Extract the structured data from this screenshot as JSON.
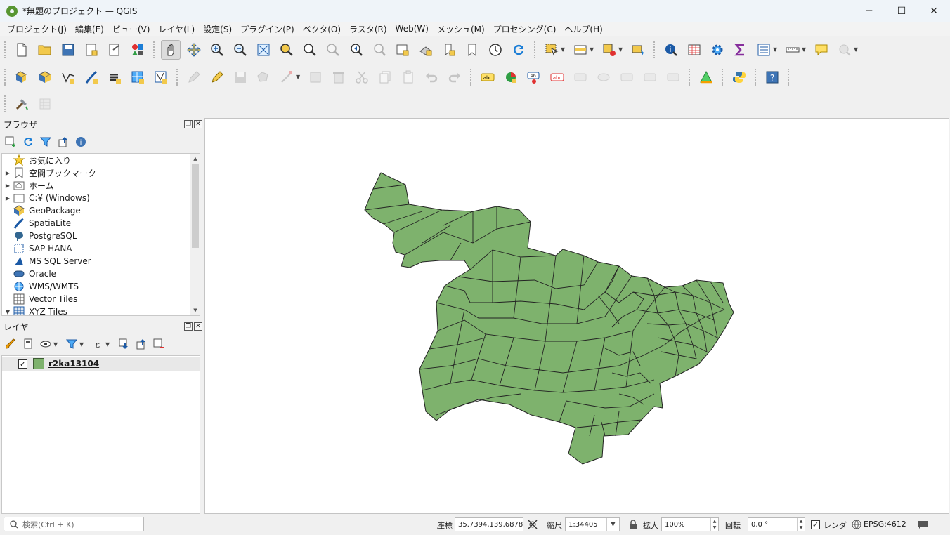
{
  "window": {
    "title": "*無題のプロジェクト — QGIS",
    "minimize": "─",
    "maximize": "☐",
    "close": "✕"
  },
  "menu": [
    "プロジェクト(J)",
    "編集(E)",
    "ビュー(V)",
    "レイヤ(L)",
    "設定(S)",
    "プラグイン(P)",
    "ベクタ(O)",
    "ラスタ(R)",
    "Web(W)",
    "メッシュ(M)",
    "プロセシング(C)",
    "ヘルプ(H)"
  ],
  "browser_panel": {
    "title": "ブラウザ",
    "items": [
      {
        "label": "お気に入り",
        "icon": "star-icon",
        "expandable": false
      },
      {
        "label": "空間ブックマーク",
        "icon": "bookmark-icon",
        "expandable": true
      },
      {
        "label": "ホーム",
        "icon": "home-folder-icon",
        "expandable": true
      },
      {
        "label": "C:¥ (Windows)",
        "icon": "drive-icon",
        "expandable": true
      },
      {
        "label": "GeoPackage",
        "icon": "geopackage-icon",
        "expandable": false
      },
      {
        "label": "SpatiaLite",
        "icon": "spatialite-icon",
        "expandable": false
      },
      {
        "label": "PostgreSQL",
        "icon": "postgresql-icon",
        "expandable": false
      },
      {
        "label": "SAP HANA",
        "icon": "sap-hana-icon",
        "expandable": false
      },
      {
        "label": "MS SQL Server",
        "icon": "mssql-icon",
        "expandable": false
      },
      {
        "label": "Oracle",
        "icon": "oracle-icon",
        "expandable": false
      },
      {
        "label": "WMS/WMTS",
        "icon": "wms-icon",
        "expandable": false
      },
      {
        "label": "Vector Tiles",
        "icon": "vector-tiles-icon",
        "expandable": false
      },
      {
        "label": "XYZ Tiles",
        "icon": "xyz-tiles-icon",
        "expandable": true
      }
    ]
  },
  "layers_panel": {
    "title": "レイヤ",
    "layers": [
      {
        "name": "r2ka13104",
        "checked": true,
        "fill_color": "#7eb26d"
      }
    ]
  },
  "statusbar": {
    "search_placeholder": "検索(Ctrl + K)",
    "coordinate_label": "座標",
    "coordinate_value": "35.7394,139.6878",
    "scale_label": "縮尺",
    "scale_value": "1:34405",
    "magnifier_label": "拡大",
    "magnifier_value": "100%",
    "rotation_label": "回転",
    "rotation_value": "0.0 °",
    "render_label": "レンダ",
    "render_checked": true,
    "crs": "EPSG:4612"
  },
  "colors": {
    "polygon_fill": "#7eb26d",
    "polygon_stroke": "#232323",
    "qgis_green": "#589632"
  }
}
